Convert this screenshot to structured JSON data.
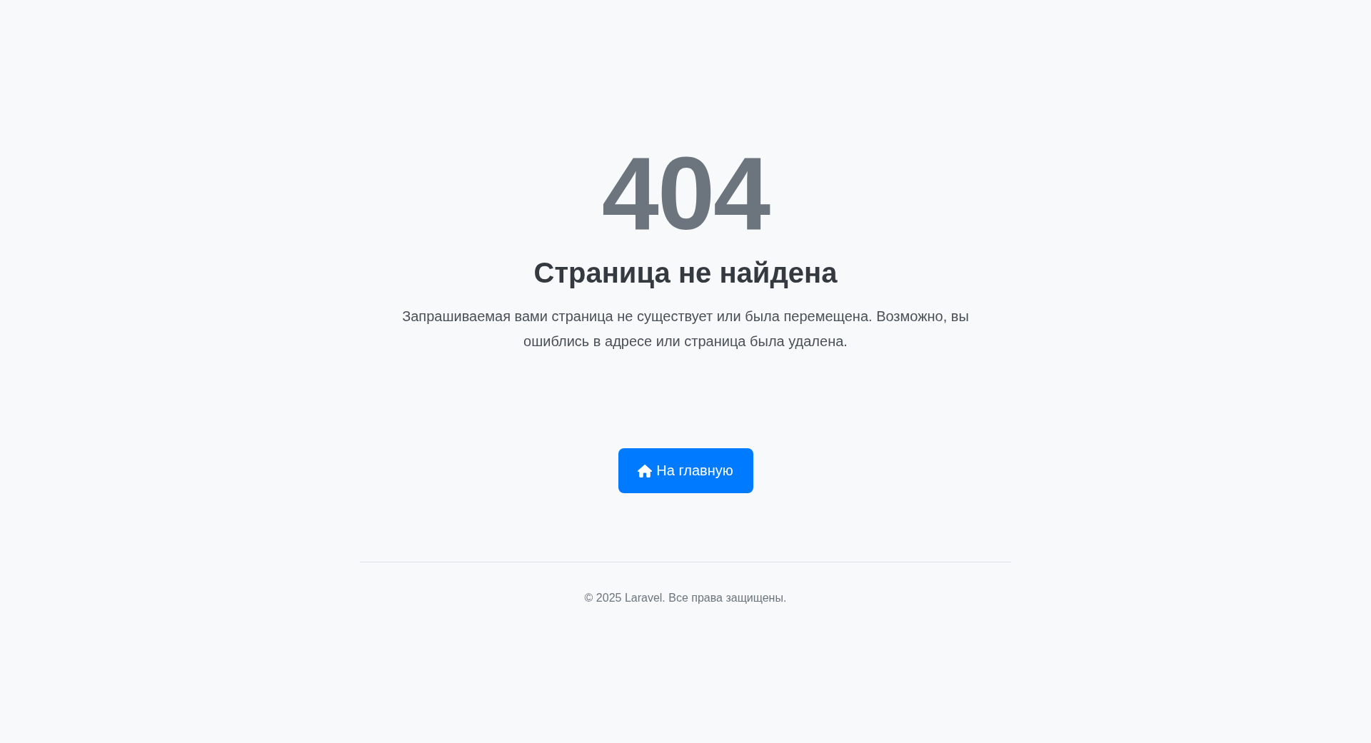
{
  "error": {
    "code": "404",
    "title": "Страница не найдена",
    "message": "Запрашиваемая вами страница не существует или была перемещена. Возможно, вы ошиблись в адресе или страница была удалена."
  },
  "home_button": {
    "label": "На главную"
  },
  "footer": {
    "text": "© 2025 Laravel. Все права защищены."
  }
}
